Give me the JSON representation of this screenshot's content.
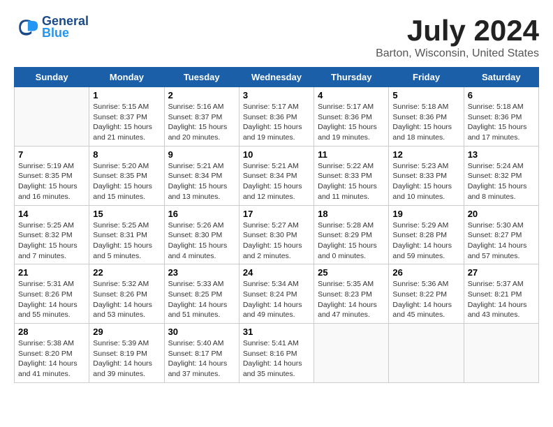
{
  "header": {
    "logo_line1": "General",
    "logo_line2": "Blue",
    "month": "July 2024",
    "location": "Barton, Wisconsin, United States"
  },
  "weekdays": [
    "Sunday",
    "Monday",
    "Tuesday",
    "Wednesday",
    "Thursday",
    "Friday",
    "Saturday"
  ],
  "weeks": [
    [
      {
        "day": "",
        "info": ""
      },
      {
        "day": "1",
        "info": "Sunrise: 5:15 AM\nSunset: 8:37 PM\nDaylight: 15 hours\nand 21 minutes."
      },
      {
        "day": "2",
        "info": "Sunrise: 5:16 AM\nSunset: 8:37 PM\nDaylight: 15 hours\nand 20 minutes."
      },
      {
        "day": "3",
        "info": "Sunrise: 5:17 AM\nSunset: 8:36 PM\nDaylight: 15 hours\nand 19 minutes."
      },
      {
        "day": "4",
        "info": "Sunrise: 5:17 AM\nSunset: 8:36 PM\nDaylight: 15 hours\nand 19 minutes."
      },
      {
        "day": "5",
        "info": "Sunrise: 5:18 AM\nSunset: 8:36 PM\nDaylight: 15 hours\nand 18 minutes."
      },
      {
        "day": "6",
        "info": "Sunrise: 5:18 AM\nSunset: 8:36 PM\nDaylight: 15 hours\nand 17 minutes."
      }
    ],
    [
      {
        "day": "7",
        "info": "Sunrise: 5:19 AM\nSunset: 8:35 PM\nDaylight: 15 hours\nand 16 minutes."
      },
      {
        "day": "8",
        "info": "Sunrise: 5:20 AM\nSunset: 8:35 PM\nDaylight: 15 hours\nand 15 minutes."
      },
      {
        "day": "9",
        "info": "Sunrise: 5:21 AM\nSunset: 8:34 PM\nDaylight: 15 hours\nand 13 minutes."
      },
      {
        "day": "10",
        "info": "Sunrise: 5:21 AM\nSunset: 8:34 PM\nDaylight: 15 hours\nand 12 minutes."
      },
      {
        "day": "11",
        "info": "Sunrise: 5:22 AM\nSunset: 8:33 PM\nDaylight: 15 hours\nand 11 minutes."
      },
      {
        "day": "12",
        "info": "Sunrise: 5:23 AM\nSunset: 8:33 PM\nDaylight: 15 hours\nand 10 minutes."
      },
      {
        "day": "13",
        "info": "Sunrise: 5:24 AM\nSunset: 8:32 PM\nDaylight: 15 hours\nand 8 minutes."
      }
    ],
    [
      {
        "day": "14",
        "info": "Sunrise: 5:25 AM\nSunset: 8:32 PM\nDaylight: 15 hours\nand 7 minutes."
      },
      {
        "day": "15",
        "info": "Sunrise: 5:25 AM\nSunset: 8:31 PM\nDaylight: 15 hours\nand 5 minutes."
      },
      {
        "day": "16",
        "info": "Sunrise: 5:26 AM\nSunset: 8:30 PM\nDaylight: 15 hours\nand 4 minutes."
      },
      {
        "day": "17",
        "info": "Sunrise: 5:27 AM\nSunset: 8:30 PM\nDaylight: 15 hours\nand 2 minutes."
      },
      {
        "day": "18",
        "info": "Sunrise: 5:28 AM\nSunset: 8:29 PM\nDaylight: 15 hours\nand 0 minutes."
      },
      {
        "day": "19",
        "info": "Sunrise: 5:29 AM\nSunset: 8:28 PM\nDaylight: 14 hours\nand 59 minutes."
      },
      {
        "day": "20",
        "info": "Sunrise: 5:30 AM\nSunset: 8:27 PM\nDaylight: 14 hours\nand 57 minutes."
      }
    ],
    [
      {
        "day": "21",
        "info": "Sunrise: 5:31 AM\nSunset: 8:26 PM\nDaylight: 14 hours\nand 55 minutes."
      },
      {
        "day": "22",
        "info": "Sunrise: 5:32 AM\nSunset: 8:26 PM\nDaylight: 14 hours\nand 53 minutes."
      },
      {
        "day": "23",
        "info": "Sunrise: 5:33 AM\nSunset: 8:25 PM\nDaylight: 14 hours\nand 51 minutes."
      },
      {
        "day": "24",
        "info": "Sunrise: 5:34 AM\nSunset: 8:24 PM\nDaylight: 14 hours\nand 49 minutes."
      },
      {
        "day": "25",
        "info": "Sunrise: 5:35 AM\nSunset: 8:23 PM\nDaylight: 14 hours\nand 47 minutes."
      },
      {
        "day": "26",
        "info": "Sunrise: 5:36 AM\nSunset: 8:22 PM\nDaylight: 14 hours\nand 45 minutes."
      },
      {
        "day": "27",
        "info": "Sunrise: 5:37 AM\nSunset: 8:21 PM\nDaylight: 14 hours\nand 43 minutes."
      }
    ],
    [
      {
        "day": "28",
        "info": "Sunrise: 5:38 AM\nSunset: 8:20 PM\nDaylight: 14 hours\nand 41 minutes."
      },
      {
        "day": "29",
        "info": "Sunrise: 5:39 AM\nSunset: 8:19 PM\nDaylight: 14 hours\nand 39 minutes."
      },
      {
        "day": "30",
        "info": "Sunrise: 5:40 AM\nSunset: 8:17 PM\nDaylight: 14 hours\nand 37 minutes."
      },
      {
        "day": "31",
        "info": "Sunrise: 5:41 AM\nSunset: 8:16 PM\nDaylight: 14 hours\nand 35 minutes."
      },
      {
        "day": "",
        "info": ""
      },
      {
        "day": "",
        "info": ""
      },
      {
        "day": "",
        "info": ""
      }
    ]
  ]
}
